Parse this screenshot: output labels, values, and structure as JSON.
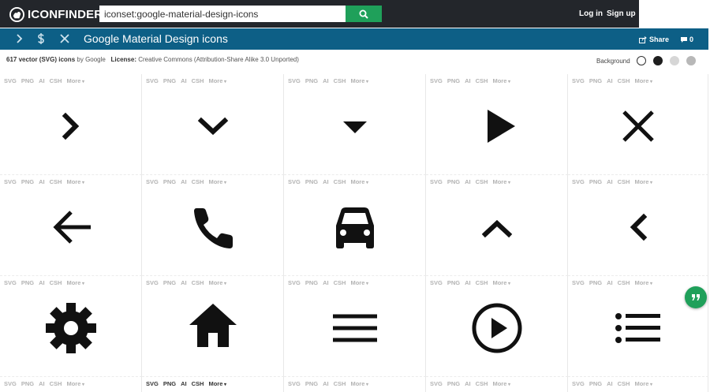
{
  "brand": {
    "name": "ICONFINDER"
  },
  "search": {
    "value": "iconset:google-material-design-icons"
  },
  "nav": {
    "login": "Log in",
    "signup": "Sign up"
  },
  "titlebar": {
    "title": "Google Material Design icons",
    "share": "Share",
    "comments": "0"
  },
  "info": {
    "count": "617 vector (SVG) icons",
    "by": "by Google",
    "license_label": "License:",
    "license": "Creative Commons (Attribution-Share Alike 3.0 Unported)"
  },
  "background": {
    "label": "Background",
    "swatches": [
      "#ffffff",
      "#1e1e1e",
      "#d6d6d6",
      "#b8b8b8"
    ]
  },
  "formats": [
    "SVG",
    "PNG",
    "AI",
    "CSH",
    "More"
  ],
  "icons": [
    "chevron-right-icon",
    "expand-more-icon",
    "arrow-drop-down-icon",
    "play-arrow-icon",
    "close-icon",
    "arrow-back-icon",
    "phone-icon",
    "directions-car-icon",
    "expand-less-icon",
    "chevron-left-icon",
    "settings-icon",
    "home-icon",
    "menu-icon",
    "play-circle-outline-icon",
    "list-icon"
  ],
  "colors": {
    "topbar": "#23262b",
    "titlebar": "#0d5f86",
    "accent": "#1fa05a"
  }
}
